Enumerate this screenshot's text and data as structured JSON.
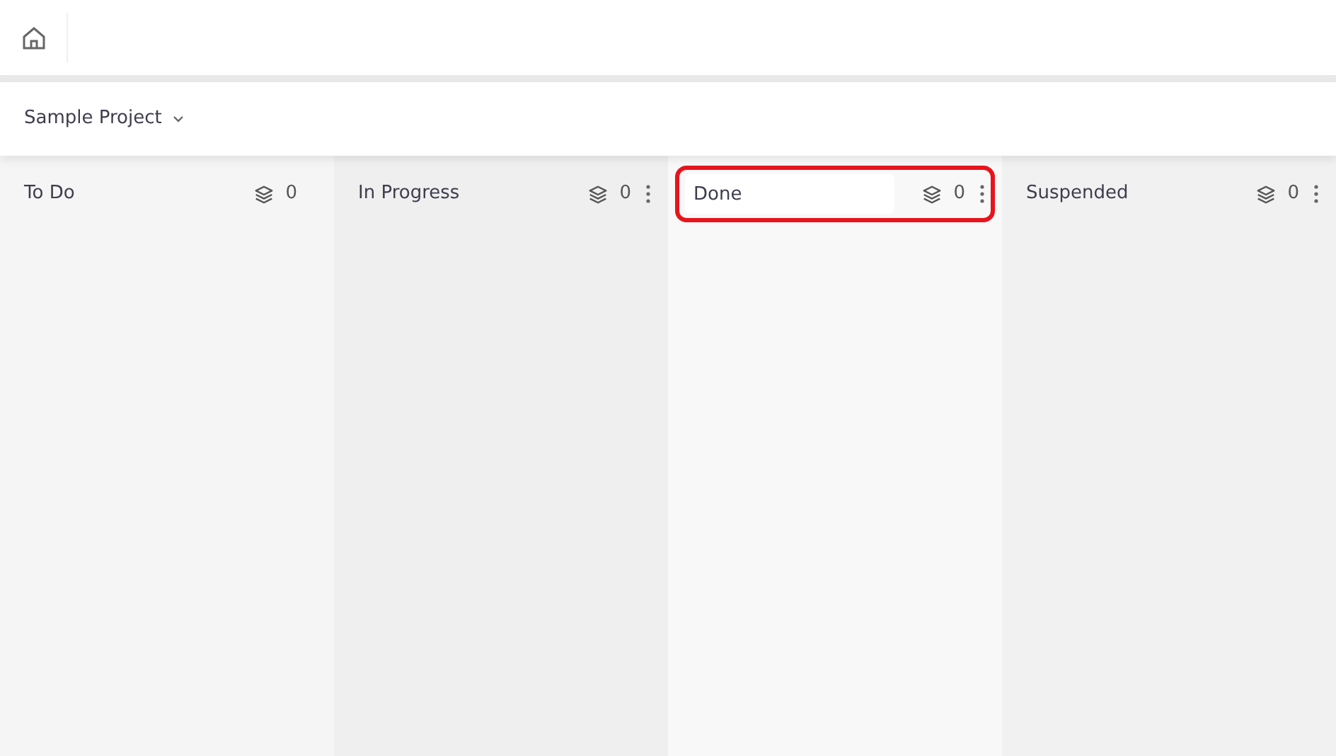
{
  "project": {
    "name": "Sample Project"
  },
  "columns": [
    {
      "title": "To Do",
      "count": "0",
      "menu": false,
      "editing": false,
      "highlighted": false
    },
    {
      "title": "In Progress",
      "count": "0",
      "menu": true,
      "editing": false,
      "highlighted": false
    },
    {
      "title": "Done",
      "count": "0",
      "menu": true,
      "editing": true,
      "highlighted": true
    },
    {
      "title": "Suspended",
      "count": "0",
      "menu": true,
      "editing": false,
      "highlighted": false
    }
  ]
}
